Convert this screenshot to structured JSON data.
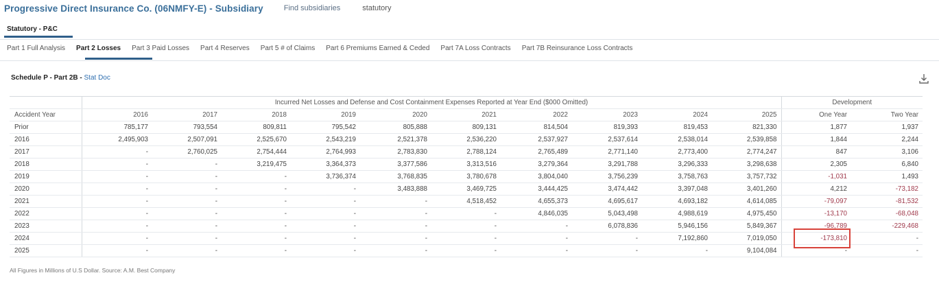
{
  "header": {
    "title": "Progressive Direct Insurance Co. (06NMFY-E) - Subsidiary",
    "link_subsidiaries": "Find subsidiaries",
    "link_statutory": "statutory"
  },
  "section_tab": "Statutory - P&C",
  "tabs": [
    {
      "label": "Part 1 Full Analysis",
      "active": false
    },
    {
      "label": "Part 2 Losses",
      "active": true
    },
    {
      "label": "Part 3 Paid Losses",
      "active": false
    },
    {
      "label": "Part 4 Reserves",
      "active": false
    },
    {
      "label": "Part 5 # of Claims",
      "active": false
    },
    {
      "label": "Part 6 Premiums Earned & Ceded",
      "active": false
    },
    {
      "label": "Part 7A Loss Contracts",
      "active": false
    },
    {
      "label": "Part 7B Reinsurance Loss Contracts",
      "active": false
    }
  ],
  "schedule": {
    "label": "Schedule P - Part 2B - ",
    "link": "Stat Doc"
  },
  "table": {
    "group_header": "Incurred Net Losses and Defense and Cost Containment Expenses Reported at Year End ($000 Omitted)",
    "dev_header": "Development",
    "columns": [
      "Accident Year",
      "2016",
      "2017",
      "2018",
      "2019",
      "2020",
      "2021",
      "2022",
      "2023",
      "2024",
      "2025",
      "One Year",
      "Two Year"
    ],
    "rows": [
      [
        "Prior",
        "785,177",
        "793,554",
        "809,811",
        "795,542",
        "805,888",
        "809,131",
        "814,504",
        "819,393",
        "819,453",
        "821,330",
        "1,877",
        "1,937"
      ],
      [
        "2016",
        "2,495,903",
        "2,507,091",
        "2,525,670",
        "2,543,219",
        "2,521,378",
        "2,536,220",
        "2,537,927",
        "2,537,614",
        "2,538,014",
        "2,539,858",
        "1,844",
        "2,244"
      ],
      [
        "2017",
        "-",
        "2,760,025",
        "2,754,444",
        "2,764,993",
        "2,783,830",
        "2,788,124",
        "2,765,489",
        "2,771,140",
        "2,773,400",
        "2,774,247",
        "847",
        "3,106"
      ],
      [
        "2018",
        "-",
        "-",
        "3,219,475",
        "3,364,373",
        "3,377,586",
        "3,313,516",
        "3,279,364",
        "3,291,788",
        "3,296,333",
        "3,298,638",
        "2,305",
        "6,840"
      ],
      [
        "2019",
        "-",
        "-",
        "-",
        "3,736,374",
        "3,768,835",
        "3,780,678",
        "3,804,040",
        "3,756,239",
        "3,758,763",
        "3,757,732",
        "-1,031",
        "1,493"
      ],
      [
        "2020",
        "-",
        "-",
        "-",
        "-",
        "3,483,888",
        "3,469,725",
        "3,444,425",
        "3,474,442",
        "3,397,048",
        "3,401,260",
        "4,212",
        "-73,182"
      ],
      [
        "2021",
        "-",
        "-",
        "-",
        "-",
        "-",
        "4,518,452",
        "4,655,373",
        "4,695,617",
        "4,693,182",
        "4,614,085",
        "-79,097",
        "-81,532"
      ],
      [
        "2022",
        "-",
        "-",
        "-",
        "-",
        "-",
        "-",
        "4,846,035",
        "5,043,498",
        "4,988,619",
        "4,975,450",
        "-13,170",
        "-68,048"
      ],
      [
        "2023",
        "-",
        "-",
        "-",
        "-",
        "-",
        "-",
        "-",
        "6,078,836",
        "5,946,156",
        "5,849,367",
        "-96,789",
        "-229,468"
      ],
      [
        "2024",
        "-",
        "-",
        "-",
        "-",
        "-",
        "-",
        "-",
        "-",
        "7,192,860",
        "7,019,050",
        "-173,810",
        "-"
      ],
      [
        "2025",
        "-",
        "-",
        "-",
        "-",
        "-",
        "-",
        "-",
        "-",
        "-",
        "9,104,084",
        "-",
        "-"
      ]
    ]
  },
  "footnote": "All Figures in Millions of U.S Dollar. Source: A.M. Best Company",
  "colors": {
    "accent": "#2f5f8a",
    "title": "#3a6f9a",
    "negative": "#a03a4c",
    "highlight": "#d8423a"
  },
  "icons": {
    "download": "download-icon"
  }
}
